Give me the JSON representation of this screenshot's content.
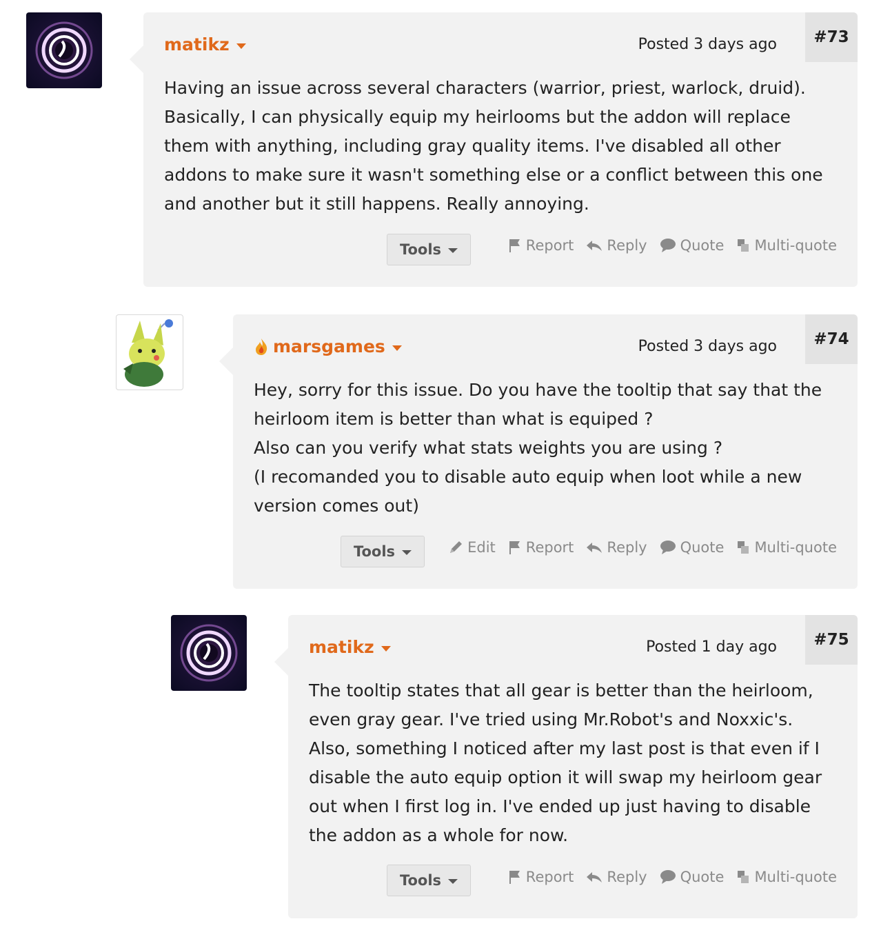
{
  "posts": [
    {
      "number": "#73",
      "author": "matikz",
      "posted": "Posted 3 days ago",
      "lines": [
        "Having an issue across several characters (warrior, priest, warlock, druid).",
        "Basically, I can physically equip my heirlooms but the addon will replace",
        "them with anything, including gray quality items. I've disabled all other",
        "addons to make sure it wasn't something else or a conflict between this one",
        "and another but it still happens. Really annoying."
      ],
      "tools": "Tools",
      "actions": {
        "report": "Report",
        "reply": "Reply",
        "quote": "Quote",
        "multiquote": "Multi-quote"
      }
    },
    {
      "number": "#74",
      "author": "marsgames",
      "posted": "Posted 3 days ago",
      "lines": [
        "Hey, sorry for this issue. Do you have the tooltip that say that the",
        "heirloom item is better than what is equiped ?",
        "Also can you verify what stats weights you are using ?",
        "(I recomanded you to disable auto equip when loot while a new",
        "version comes out)"
      ],
      "tools": "Tools",
      "actions": {
        "edit": "Edit",
        "report": "Report",
        "reply": "Reply",
        "quote": "Quote",
        "multiquote": "Multi-quote"
      }
    },
    {
      "number": "#75",
      "author": "matikz",
      "posted": "Posted 1 day ago",
      "lines": [
        "The tooltip states that all gear is better than the heirloom,",
        "even gray gear. I've tried using Mr.Robot's and Noxxic's.",
        "Also, something I noticed after my last post is that even if I",
        "disable the auto equip option it will swap my heirloom gear",
        "out when I first log in. I've ended up just having to disable",
        "the addon as a whole for now."
      ],
      "tools": "Tools",
      "actions": {
        "report": "Report",
        "reply": "Reply",
        "quote": "Quote",
        "multiquote": "Multi-quote"
      }
    }
  ],
  "colors": {
    "author": "#e0691b",
    "card": "#f2f2f2",
    "action": "#8a8a8a"
  }
}
